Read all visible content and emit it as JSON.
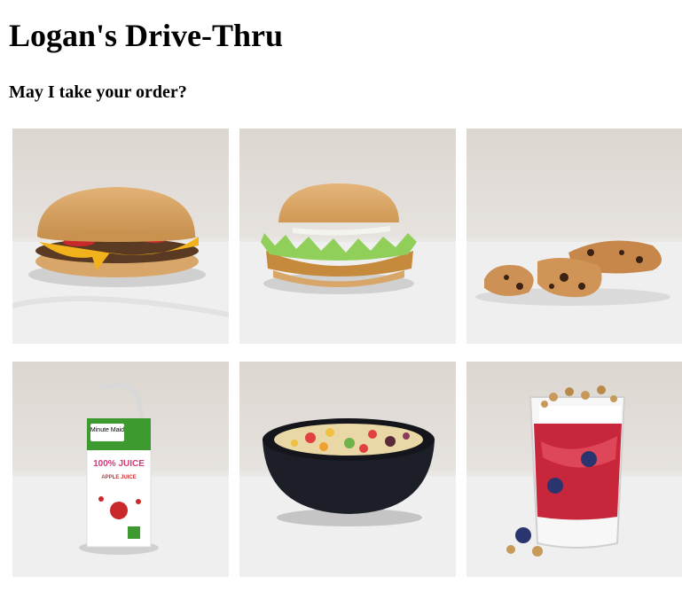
{
  "page": {
    "title": "Logan's Drive-Thru",
    "subtitle": "May I take your order?"
  },
  "menu": {
    "items": [
      {
        "icon": "cheeseburger-icon"
      },
      {
        "icon": "chicken-sandwich-icon"
      },
      {
        "icon": "cookies-icon"
      },
      {
        "icon": "juice-box-icon",
        "brand": "Minute Maid",
        "label": "100% JUICE",
        "sub": "APPLE JUICE"
      },
      {
        "icon": "fruit-bowl-icon"
      },
      {
        "icon": "yogurt-parfait-icon"
      }
    ]
  }
}
